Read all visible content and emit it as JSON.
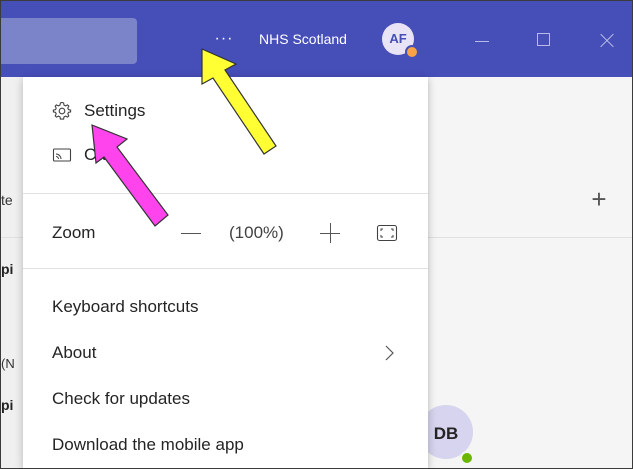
{
  "titlebar": {
    "more_options": "···",
    "org_name": "NHS Scotland",
    "avatar_initials": "AF"
  },
  "background": {
    "left_fragments": [
      "te",
      "pi",
      "(N",
      "pi"
    ],
    "avatar_initials": "DB"
  },
  "menu": {
    "settings": "Settings",
    "cast": "Ca",
    "zoom_label": "Zoom",
    "zoom_value": "(100%)",
    "keyboard_shortcuts": "Keyboard shortcuts",
    "about": "About",
    "check_updates": "Check for updates",
    "download_app": "Download the mobile app"
  },
  "annotations": {
    "arrow_yellow_color": "#ffff33",
    "arrow_magenta_color": "#ff44ee"
  }
}
